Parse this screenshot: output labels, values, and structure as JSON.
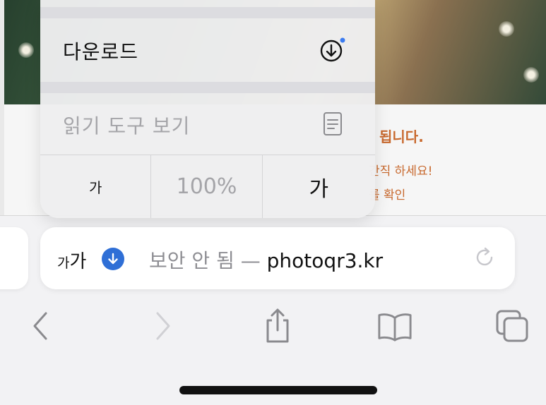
{
  "background_page": {
    "heading": "됩니다.",
    "line1": "간직 하세요!",
    "line2": "를 확인"
  },
  "menu": {
    "items": [
      {
        "label": "다운로드",
        "icon": "download-circle-icon",
        "has_badge": true,
        "enabled": true
      },
      {
        "label": "읽기 도구 보기",
        "icon": "reader-view-icon",
        "enabled": false
      }
    ],
    "zoom": {
      "decrease_label": "가",
      "level": "100%",
      "increase_label": "가"
    }
  },
  "address_bar": {
    "aa_small": "가",
    "aa_big": "가",
    "download_indicator": "download-arrow-icon",
    "insecure_label": "보안 안 됨",
    "separator": "—",
    "domain": "photoqr3.kr",
    "reload_icon": "reload-icon"
  },
  "toolbar": {
    "buttons": [
      "back-icon",
      "forward-icon",
      "share-icon",
      "bookmarks-icon",
      "tabs-icon"
    ]
  },
  "colors": {
    "accent": "#2f6fd6",
    "badge_dot": "#3b7bf0",
    "page_text": "#c8692e",
    "toolbar_icon": "#8a8a8e",
    "disabled": "#a4a4a8"
  }
}
